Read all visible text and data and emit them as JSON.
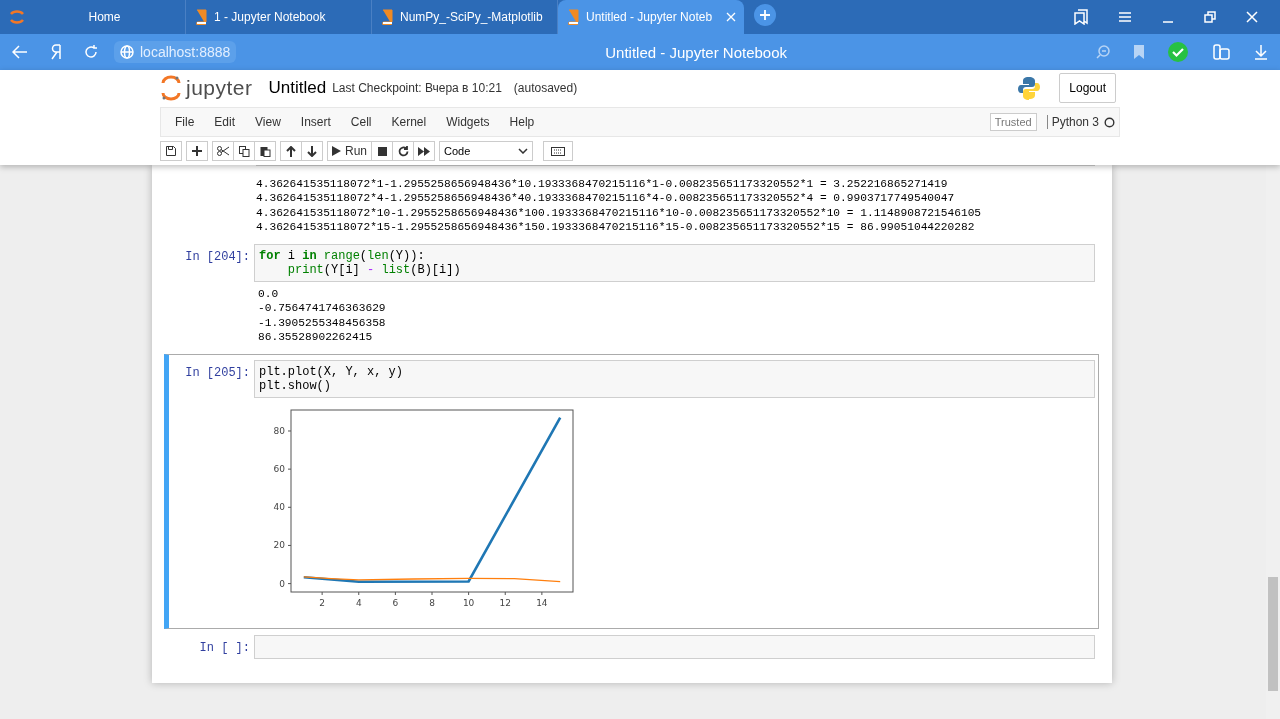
{
  "browser": {
    "tabs": [
      {
        "title": "Home",
        "selected": false
      },
      {
        "title": "1 - Jupyter Notebook",
        "selected": false
      },
      {
        "title": "NumPy_-SciPy_-Matplotlib",
        "selected": false
      },
      {
        "title": "Untitled - Jupyter Noteb",
        "selected": true
      }
    ],
    "address": "localhost:8888",
    "page_title": "Untitled - Jupyter Notebook"
  },
  "header": {
    "logo_text": "jupyter",
    "notebook_name": "Untitled",
    "checkpoint": "Last Checkpoint: Вчера в 10:21",
    "autosave": "(autosaved)",
    "logout": "Logout"
  },
  "menu": {
    "items": [
      "File",
      "Edit",
      "View",
      "Insert",
      "Cell",
      "Kernel",
      "Widgets",
      "Help"
    ],
    "trusted": "Trusted",
    "kernel": "Python 3"
  },
  "toolbar": {
    "run": "Run",
    "cell_type": "Code"
  },
  "cells": [
    {
      "kind": "output",
      "lines": [
        "4.362641535118072*1-1.2955258656948436*10.1933368470215116*1-0.008235651173320552*1 = 3.252216865271419",
        "4.362641535118072*4-1.2955258656948436*40.1933368470215116*4-0.008235651173320552*4 = 0.9903717749540047",
        "4.362641535118072*10-1.2955258656948436*100.1933368470215116*10-0.008235651173320552*10 = 1.1148908721546105",
        "4.362641535118072*15-1.2955258656948436*150.1933368470215116*15-0.008235651173320552*15 = 86.99051044220282"
      ]
    },
    {
      "kind": "code",
      "prompt": "In [204]:",
      "selected": false,
      "code": [
        [
          {
            "text": "for",
            "kind": "keyword"
          },
          {
            "text": " i ",
            "kind": "plain"
          },
          {
            "text": "in",
            "kind": "keyword"
          },
          {
            "text": " range",
            "kind": "builtin"
          },
          {
            "text": "(",
            "kind": "plain"
          },
          {
            "text": "len",
            "kind": "builtin"
          },
          {
            "text": "(Y)):",
            "kind": "plain"
          }
        ],
        [
          {
            "text": "    print",
            "kind": "builtin"
          },
          {
            "text": "(Y[i] ",
            "kind": "plain"
          },
          {
            "text": "-",
            "kind": "operator"
          },
          {
            "text": " list",
            "kind": "builtin"
          },
          {
            "text": "(B)[i])",
            "kind": "plain"
          }
        ]
      ],
      "output": [
        "0.0",
        "-0.7564741746363629",
        "-1.3905255348456358",
        "86.35528902262415"
      ]
    },
    {
      "kind": "code",
      "prompt": "In [205]:",
      "selected": true,
      "code": [
        [
          {
            "text": "plt.plot(X, Y, x, y)",
            "kind": "plain"
          }
        ],
        [
          {
            "text": "plt.show()",
            "kind": "plain"
          }
        ]
      ],
      "chart_data": {
        "type": "line",
        "x": [
          1,
          4,
          10,
          15
        ],
        "xlim": [
          0.3,
          15.7
        ],
        "ylim": [
          -4.4,
          91
        ],
        "xticks": [
          2,
          4,
          6,
          8,
          10,
          12,
          14
        ],
        "yticks": [
          0,
          20,
          40,
          60,
          80
        ],
        "series": [
          {
            "color": "#1f77b4",
            "values": [
              3.3,
              1,
              1.1,
              87
            ]
          },
          {
            "color": "#ff7f0e",
            "x": [
              1,
              2.5,
              4,
              7,
              10,
              12.5,
              15
            ],
            "values": [
              3.5,
              2.6,
              2.0,
              2.4,
              2.8,
              2.6,
              1.0
            ]
          }
        ]
      }
    },
    {
      "kind": "code",
      "prompt": "In [ ]:",
      "selected": false
    }
  ]
}
